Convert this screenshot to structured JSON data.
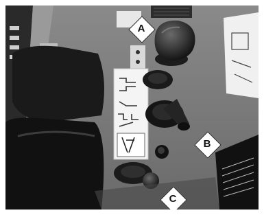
{
  "callouts": {
    "a": {
      "label": "A",
      "points_to": "seat-adjustment-lever"
    },
    "b": {
      "label": "B",
      "points_to": "hydraulic-joystick-lever"
    },
    "c": {
      "label": "C",
      "points_to": "travel-lever-knob"
    }
  },
  "colors": {
    "panel": "#3a3a3a",
    "callout_fill": "#ffffff",
    "callout_text": "#111111"
  }
}
